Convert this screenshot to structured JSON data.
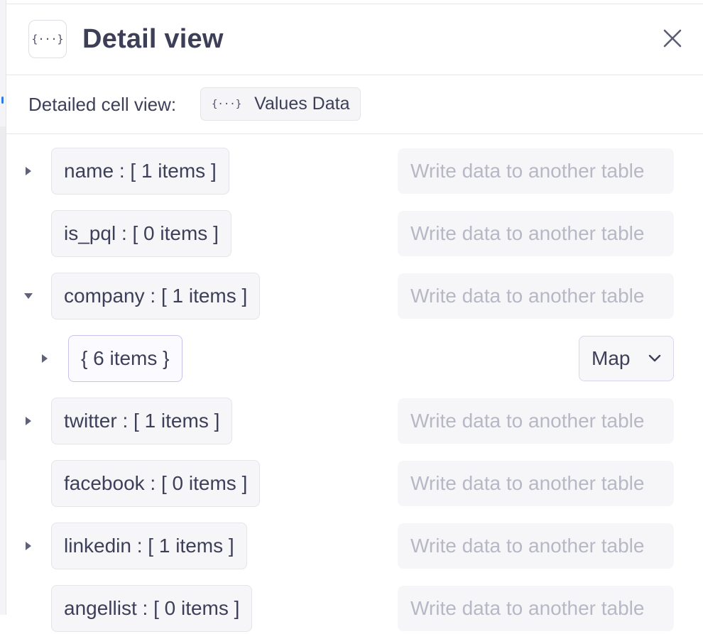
{
  "header": {
    "icon": "{···}",
    "title": "Detail view"
  },
  "subheader": {
    "label": "Detailed cell view:",
    "chip_icon": "{···}",
    "chip_label": "Values Data"
  },
  "write_placeholder": "Write data to another table",
  "rows": [
    {
      "label": "name : [ 1 items ]",
      "caret": "right"
    },
    {
      "label": "is_pql : [ 0 items ]",
      "caret": "none"
    },
    {
      "label": "company : [ 1 items ]",
      "caret": "down"
    },
    {
      "label": "{ 6 items }",
      "caret": "right",
      "nested": true,
      "action": "Map"
    },
    {
      "label": "twitter : [ 1 items ]",
      "caret": "right"
    },
    {
      "label": "facebook : [ 0 items ]",
      "caret": "none"
    },
    {
      "label": "linkedin : [ 1 items ]",
      "caret": "right"
    },
    {
      "label": "angellist : [ 0 items ]",
      "caret": "none"
    }
  ],
  "colors": {
    "text": "#3d3f59",
    "placeholder": "#b7b8c6",
    "chip_bg": "#f6f6f8",
    "selected_border": "#c8c3ec"
  },
  "icons": {
    "close": "close-icon",
    "expand": "caret-right-icon",
    "collapse": "caret-down-icon",
    "dropdown": "chevron-down-icon",
    "braces": "braces-icon"
  }
}
